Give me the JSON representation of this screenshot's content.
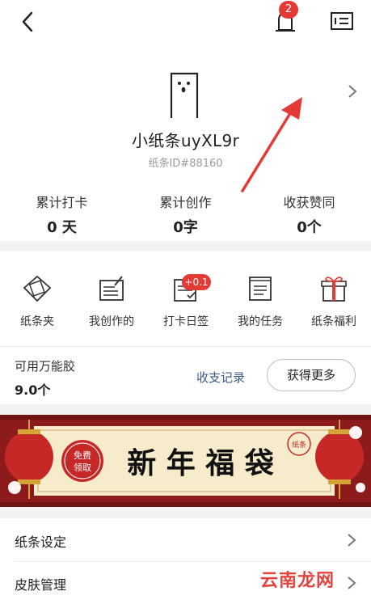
{
  "header": {
    "notification_count": "2",
    "icons": {
      "back": "back-arrow-icon",
      "bell": "bell-icon",
      "card": "id-card-icon"
    }
  },
  "profile": {
    "username": "小纸条uyXL9r",
    "user_id": "纸条ID#88160"
  },
  "stats": [
    {
      "label": "累计打卡",
      "value": "0 天"
    },
    {
      "label": "累计创作",
      "value": "0字"
    },
    {
      "label": "收获赞同",
      "value": "0个"
    }
  ],
  "features": [
    {
      "label": "纸条夹",
      "icon": "note-folder-icon"
    },
    {
      "label": "我创作的",
      "icon": "edit-note-icon"
    },
    {
      "label": "打卡日签",
      "icon": "checkin-calendar-icon"
    },
    {
      "label": "我的任务",
      "icon": "scroll-task-icon"
    },
    {
      "label": "纸条福利",
      "icon": "gift-box-icon"
    }
  ],
  "checkin_badge": "+0.1",
  "glue": {
    "title": "可用万能胶",
    "value": "9.0个",
    "records_link": "收支记录",
    "more_button": "获得更多"
  },
  "banner": {
    "badge_line1": "免费",
    "badge_line2": "领取",
    "title": "新 年 福 袋",
    "seal_char": "纸条"
  },
  "menu": [
    {
      "label": "纸条设定"
    },
    {
      "label": "皮肤管理"
    }
  ],
  "watermark": "云南龙网",
  "colors": {
    "accent_red": "#e53935",
    "link_blue": "#3c5a8a",
    "banner_dark_red": "#8e1b1b",
    "banner_cream": "#f6eccb"
  }
}
